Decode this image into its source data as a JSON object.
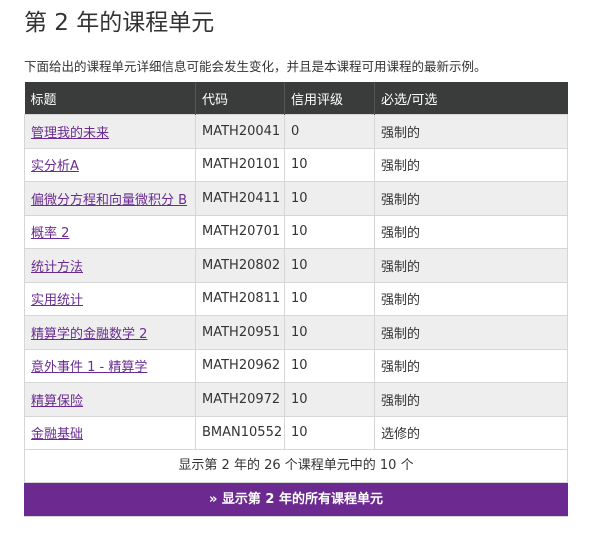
{
  "page": {
    "title": "第 2 年的课程单元",
    "intro": "下面给出的课程单元详细信息可能会发生变化，并且是本课程可用课程的最新示例。"
  },
  "table": {
    "headers": [
      "标题",
      "代码",
      "信用评级",
      "必选/可选"
    ],
    "rows": [
      {
        "title": "管理我的未来",
        "code": "MATH20041",
        "credits": "0",
        "status": "强制的"
      },
      {
        "title": "实分析A",
        "code": "MATH20101",
        "credits": "10",
        "status": "强制的"
      },
      {
        "title": "偏微分方程和向量微积分 B",
        "code": "MATH20411",
        "credits": "10",
        "status": "强制的"
      },
      {
        "title": "概率 2",
        "code": "MATH20701",
        "credits": "10",
        "status": "强制的"
      },
      {
        "title": "统计方法",
        "code": "MATH20802",
        "credits": "10",
        "status": "强制的"
      },
      {
        "title": "实用统计",
        "code": "MATH20811",
        "credits": "10",
        "status": "强制的"
      },
      {
        "title": "精算学的金融数学 2",
        "code": "MATH20951",
        "credits": "10",
        "status": "强制的"
      },
      {
        "title": "意外事件 1 - 精算学",
        "code": "MATH20962",
        "credits": "10",
        "status": "强制的"
      },
      {
        "title": "精算保险",
        "code": "MATH20972",
        "credits": "10",
        "status": "强制的"
      },
      {
        "title": "金融基础",
        "code": "BMAN10552",
        "credits": "10",
        "status": "选修的"
      }
    ]
  },
  "footer": {
    "summary": "显示第 2 年的 26 个课程单元中的 10 个",
    "show_all_label": "» 显示第 2 年的所有课程单元"
  },
  "colors": {
    "header_bg": "#3a3c3c",
    "link": "#6a2c91",
    "button_bg": "#6c2a90"
  }
}
